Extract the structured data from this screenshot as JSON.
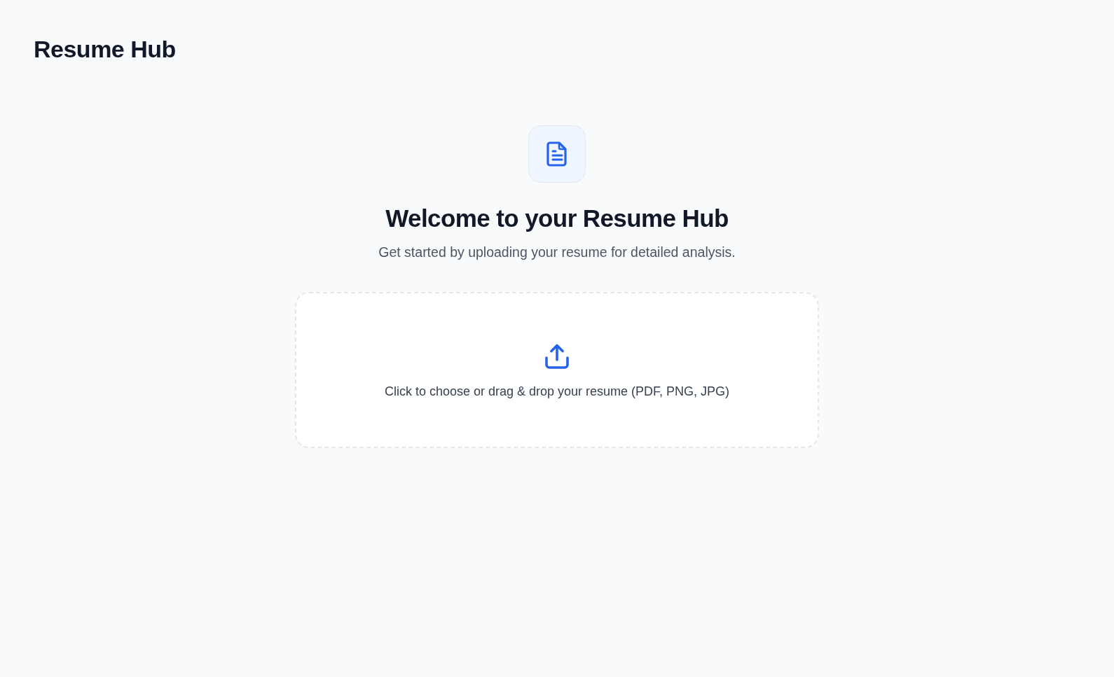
{
  "header": {
    "title": "Resume Hub"
  },
  "hero": {
    "heading": "Welcome to your Resume Hub",
    "subtitle": "Get started by uploading your resume for detailed analysis."
  },
  "dropzone": {
    "text": "Click to choose or drag & drop your resume (PDF, PNG, JPG)"
  }
}
